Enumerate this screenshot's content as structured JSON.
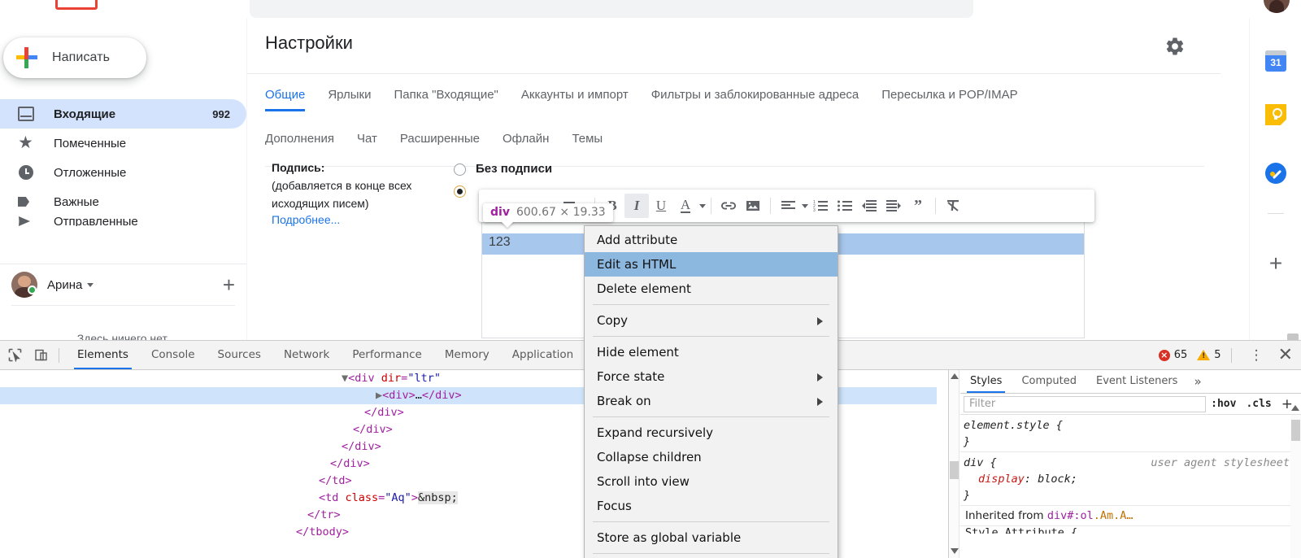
{
  "gmail": {
    "compose_label": "Написать",
    "nav": [
      {
        "label": "Входящие",
        "count": "992",
        "icon": "inbox-icon",
        "active": true
      },
      {
        "label": "Помеченные",
        "count": "",
        "icon": "star-icon",
        "active": false
      },
      {
        "label": "Отложенные",
        "count": "",
        "icon": "clock-icon",
        "active": false
      },
      {
        "label": "Важные",
        "count": "",
        "icon": "label-icon",
        "active": false
      },
      {
        "label": "Отправленные",
        "count": "",
        "icon": "send-icon",
        "active": false
      }
    ],
    "account_name": "Арина",
    "empty_note": "Здесь ничего нет.",
    "rail": {
      "calendar_day": "31",
      "calendar_name": "calendar-icon",
      "keep_name": "keep-icon",
      "tasks_name": "tasks-icon",
      "plus_label": "+"
    }
  },
  "settings": {
    "title": "Настройки",
    "tabs_row1": [
      {
        "label": "Общие",
        "active": true
      },
      {
        "label": "Ярлыки",
        "active": false
      },
      {
        "label": "Папка \"Входящие\"",
        "active": false
      },
      {
        "label": "Аккаунты и импорт",
        "active": false
      },
      {
        "label": "Фильтры и заблокированные адреса",
        "active": false
      },
      {
        "label": "Пересылка и POP/IMAP",
        "active": false
      }
    ],
    "tabs_row2": [
      {
        "label": "Дополнения",
        "active": false
      },
      {
        "label": "Чат",
        "active": false
      },
      {
        "label": "Расширенные",
        "active": false
      },
      {
        "label": "Офлайн",
        "active": false
      },
      {
        "label": "Темы",
        "active": false
      }
    ],
    "signature": {
      "title": "Подпись:",
      "note": "(добавляется в конце всех исходящих писем)",
      "more_link": "Подробнее...",
      "option_none": "Без подписи",
      "editor_text": "123"
    },
    "toolbar": {
      "bold": "B",
      "italic": "I",
      "underline": "U",
      "text_color": "A",
      "quote": "”"
    }
  },
  "inspector_badge": {
    "tag": "div",
    "dimensions": "600.67 × 19.33"
  },
  "devtools": {
    "tabs": [
      {
        "label": "Elements",
        "active": true
      },
      {
        "label": "Console",
        "active": false
      },
      {
        "label": "Sources",
        "active": false
      },
      {
        "label": "Network",
        "active": false
      },
      {
        "label": "Performance",
        "active": false
      },
      {
        "label": "Memory",
        "active": false
      },
      {
        "label": "Application",
        "active": false
      }
    ],
    "error_count": "65",
    "warning_count": "5",
    "dom_rows": [
      {
        "indent": 30,
        "html": "<span class=\"arrow\">▼</span><span class=\"tagp\">&lt;div </span><span class=\"attr\">dir</span><span class=\"tagp\">=</span><span class=\"val\">\"ltr\"</span>",
        "selected": false
      },
      {
        "indent": 33,
        "html": "<span class=\"arrow\">▶</span><span class=\"tagp\">&lt;div&gt;</span>…<span class=\"tagp\">&lt;/div&gt;</span>",
        "selected": true
      },
      {
        "indent": 32,
        "html": "<span class=\"tagp\">&lt;/div&gt;</span>",
        "selected": false
      },
      {
        "indent": 31,
        "html": "<span class=\"tagp\">&lt;/div&gt;</span>",
        "selected": false
      },
      {
        "indent": 30,
        "html": "<span class=\"tagp\">&lt;/div&gt;</span>",
        "selected": false
      },
      {
        "indent": 29,
        "html": "<span class=\"tagp\">&lt;/div&gt;</span>",
        "selected": false
      },
      {
        "indent": 28,
        "html": "<span class=\"tagp\">&lt;/td&gt;</span>",
        "selected": false
      },
      {
        "indent": 28,
        "html": "<span class=\"tagp\">&lt;td </span><span class=\"attr\">class</span><span class=\"tagp\">=</span><span class=\"val\">\"Aq\"</span><span class=\"tagp\">&gt;</span><span class=\"ent\">&amp;nbsp;</span>",
        "selected": false
      },
      {
        "indent": 27,
        "html": "<span class=\"tagp\">&lt;/tr&gt;</span>",
        "selected": false
      },
      {
        "indent": 26,
        "html": "<span class=\"tagp\">&lt;/tbody&gt;</span>",
        "selected": false
      }
    ],
    "styles": {
      "tabs": [
        {
          "label": "Styles",
          "active": true
        },
        {
          "label": "Computed",
          "active": false
        },
        {
          "label": "Event Listeners",
          "active": false
        }
      ],
      "more_label": "»",
      "filter_placeholder": "Filter",
      "hov_label": ":hov",
      "cls_label": ".cls",
      "plus_label": "+",
      "rules": [
        {
          "selector": "element.style {",
          "origin": "",
          "declarations": [],
          "close": "}"
        },
        {
          "selector": "div {",
          "origin": "user agent stylesheet",
          "declarations": [
            {
              "prop": "display",
              "value": "block;"
            }
          ],
          "close": "}"
        }
      ],
      "inherited_prefix": "Inherited from ",
      "inherited_tag": "div",
      "inherited_rest": "#:ol",
      "inherited_classes": ".Am.A…",
      "partial_row": "Style Attribute {"
    }
  },
  "context_menu": {
    "items": [
      {
        "label": "Add attribute",
        "submenu": false,
        "highlighted": false,
        "divider_after": false
      },
      {
        "label": "Edit as HTML",
        "submenu": false,
        "highlighted": true,
        "divider_after": false
      },
      {
        "label": "Delete element",
        "submenu": false,
        "highlighted": false,
        "divider_after": true
      },
      {
        "label": "Copy",
        "submenu": true,
        "highlighted": false,
        "divider_after": true
      },
      {
        "label": "Hide element",
        "submenu": false,
        "highlighted": false,
        "divider_after": false
      },
      {
        "label": "Force state",
        "submenu": true,
        "highlighted": false,
        "divider_after": false
      },
      {
        "label": "Break on",
        "submenu": true,
        "highlighted": false,
        "divider_after": true
      },
      {
        "label": "Expand recursively",
        "submenu": false,
        "highlighted": false,
        "divider_after": false
      },
      {
        "label": "Collapse children",
        "submenu": false,
        "highlighted": false,
        "divider_after": false
      },
      {
        "label": "Scroll into view",
        "submenu": false,
        "highlighted": false,
        "divider_after": false
      },
      {
        "label": "Focus",
        "submenu": false,
        "highlighted": false,
        "divider_after": true
      },
      {
        "label": "Store as global variable",
        "submenu": false,
        "highlighted": false,
        "divider_after": true
      }
    ]
  },
  "colors": {
    "accent": "#1a73e8",
    "selection": "#a8c7ec",
    "menu_highlight": "#8cb8e0",
    "error": "#d93025",
    "warning": "#f9ab00"
  }
}
